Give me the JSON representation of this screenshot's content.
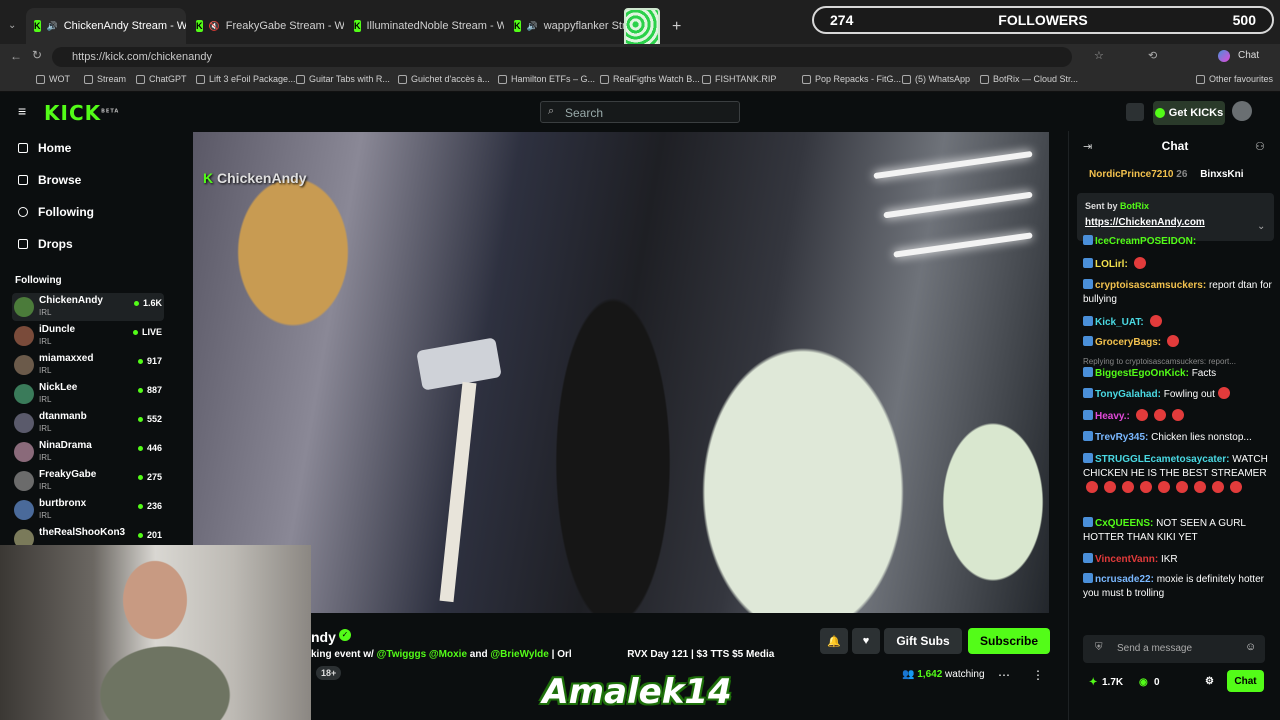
{
  "browser": {
    "tabs": [
      {
        "label": "ChickenAndy Stream - Watch"
      },
      {
        "label": "FreakyGabe Stream - Watch L"
      },
      {
        "label": "IlluminatedNoble Stream - Watch"
      },
      {
        "label": "wappyflanker Stream -"
      }
    ],
    "url": "https://kick.com/chickenandy",
    "bookmarks": [
      "WOT",
      "Stream",
      "ChatGPT",
      "Lift 3 eFoil Package...",
      "Guitar Tabs with R...",
      "Guichet d'accès à...",
      "Hamilton ETFs – G...",
      "RealFigths Watch B...",
      "FISHTANK.RIP",
      "Pop Repacks - FitG...",
      "(5) WhatsApp",
      "BotRix — Cloud Str..."
    ],
    "other_favourites": "Other favourites",
    "chat_button": "Chat"
  },
  "overlay": {
    "followers_current": "274",
    "followers_label": "FOLLOWERS",
    "followers_goal": "500",
    "logo_text": "Amalek14"
  },
  "nav": {
    "logo": "KICK",
    "beta": "BETA",
    "search_placeholder": "Search",
    "get_kicks": "Get KICKs"
  },
  "sidebar": {
    "menu": [
      "Home",
      "Browse",
      "Following",
      "Drops"
    ],
    "following_header": "Following",
    "channels": [
      {
        "name": "ChickenAndy",
        "category": "IRL",
        "viewers": "1.6K"
      },
      {
        "name": "iDuncle",
        "category": "IRL",
        "viewers": "LIVE"
      },
      {
        "name": "miamaxxed",
        "category": "IRL",
        "viewers": "917"
      },
      {
        "name": "NickLee",
        "category": "IRL",
        "viewers": "887"
      },
      {
        "name": "dtanmanb",
        "category": "IRL",
        "viewers": "552"
      },
      {
        "name": "NinaDrama",
        "category": "IRL",
        "viewers": "446"
      },
      {
        "name": "FreakyGabe",
        "category": "IRL",
        "viewers": "275"
      },
      {
        "name": "burtbronx",
        "category": "IRL",
        "viewers": "236"
      },
      {
        "name": "theRealShooKon3",
        "category": "",
        "viewers": "201"
      }
    ]
  },
  "video": {
    "watermark": "ChickenAndy"
  },
  "stream": {
    "name_fragment": "ndy",
    "title_prefix": "king event w/",
    "mentions": [
      "@Twigggs",
      "@Moxie",
      "@BrieWylde"
    ],
    "title_and": "and",
    "title_suffix": "| Orl",
    "title_suffix2": "RVX Day 121 | $3 TTS $5 Media",
    "age_badge": "18+",
    "gift_subs": "Gift Subs",
    "subscribe": "Subscribe",
    "watching_count": "1,642",
    "watching_label": "watching"
  },
  "chat": {
    "header": "Chat",
    "top_gifter_1": "NordicPrince7210",
    "top_gifter_1_count": "26",
    "top_gifter_2": "BinxsKni",
    "pinned_sent_by": "Sent by",
    "pinned_bot": "BotRix",
    "pinned_link": "https://ChickenAndy.com",
    "messages": [
      {
        "user": "IceCreamPOSEIDON:",
        "text": "",
        "color": "#53fc18"
      },
      {
        "user": "LOLirl:",
        "text": "",
        "color": "#f2e14e"
      },
      {
        "user": "cryptoisascamsuckers:",
        "text": "report dtan for bullying",
        "color": "#f2c14e"
      },
      {
        "user": "Kick_UAT:",
        "text": "",
        "color": "#4ad9e3"
      },
      {
        "user": "GroceryBags:",
        "text": "",
        "color": "#f2c14e"
      },
      {
        "user": "",
        "text": "Replying to cryptoisascamsuckers: report...",
        "color": "#888"
      },
      {
        "user": "BiggestEgoOnKick:",
        "text": "Facts",
        "color": "#53fc18"
      },
      {
        "user": "TonyGalahad:",
        "text": "Fowling out",
        "color": "#4ad9e3"
      },
      {
        "user": "Heavy.:",
        "text": "",
        "color": "#e24ad9"
      },
      {
        "user": "TrevRy345:",
        "text": "Chicken lies nonstop...",
        "color": "#7ab8ff"
      },
      {
        "user": "STRUGGLEcametosaycater:",
        "text": "WATCH CHICKEN HE IS THE BEST STREAMER",
        "color": "#4ad9e3"
      },
      {
        "user": "CxQUEENS:",
        "text": "NOT SEEN A GURL HOTTER THAN KIKI YET",
        "color": "#53fc18"
      },
      {
        "user": "VincentVann:",
        "text": "IKR",
        "color": "#e23b3b"
      },
      {
        "user": "ncrusade22:",
        "text": "moxie is definitely hotter you must b trolling",
        "color": "#7ab8ff"
      }
    ],
    "input_placeholder": "Send a message",
    "kicks_count": "1.7K",
    "points": "0",
    "send_label": "Chat"
  }
}
